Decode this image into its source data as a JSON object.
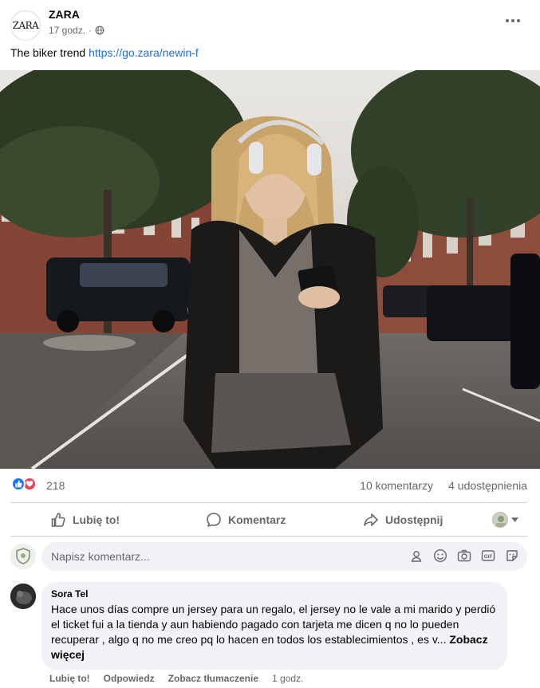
{
  "post": {
    "page_name": "ZARA",
    "logo_text": "ZARA",
    "timestamp": "17 godz.",
    "separator": "·",
    "caption_text": "The biker trend ",
    "caption_link": "https://go.zara/newin-f"
  },
  "stats": {
    "reaction_count": "218",
    "comments": "10 komentarzy",
    "shares": "4 udostępnienia"
  },
  "actions": {
    "like": "Lubię to!",
    "comment": "Komentarz",
    "share": "Udostępnij"
  },
  "composer": {
    "placeholder": "Napisz komentarz..."
  },
  "comment": {
    "author": "Sora Tel",
    "text": "Hace unos días compre un jersey para un regalo, el jersey no le vale a mi marido y perdió el ticket fui a la tienda y aun habiendo pagado con tarjeta me dicen q no lo pueden recuperar , algo q no me creo pq lo hacen en todos los establecimientos , es v...",
    "see_more": "Zobacz więcej",
    "like": "Lubię to!",
    "reply": "Odpowiedz",
    "translate": "Zobacz tłumaczenie",
    "time": "1 godz."
  },
  "icons": {
    "globe": "globe-icon",
    "more": "more-horizontal-icon",
    "like": "thumbs-up-icon",
    "comment": "speech-bubble-icon",
    "share": "share-arrow-icon",
    "emoji": "emoji-icon",
    "camera": "camera-icon",
    "gif": "gif-icon",
    "sticker": "sticker-icon",
    "avatar_shield": "avatar-shield-icon"
  },
  "colors": {
    "link": "#216fdb",
    "like_blue": "#1877f2",
    "love_red": "#f33e58",
    "muted": "#65676b",
    "bubble": "#f0f2f5"
  }
}
